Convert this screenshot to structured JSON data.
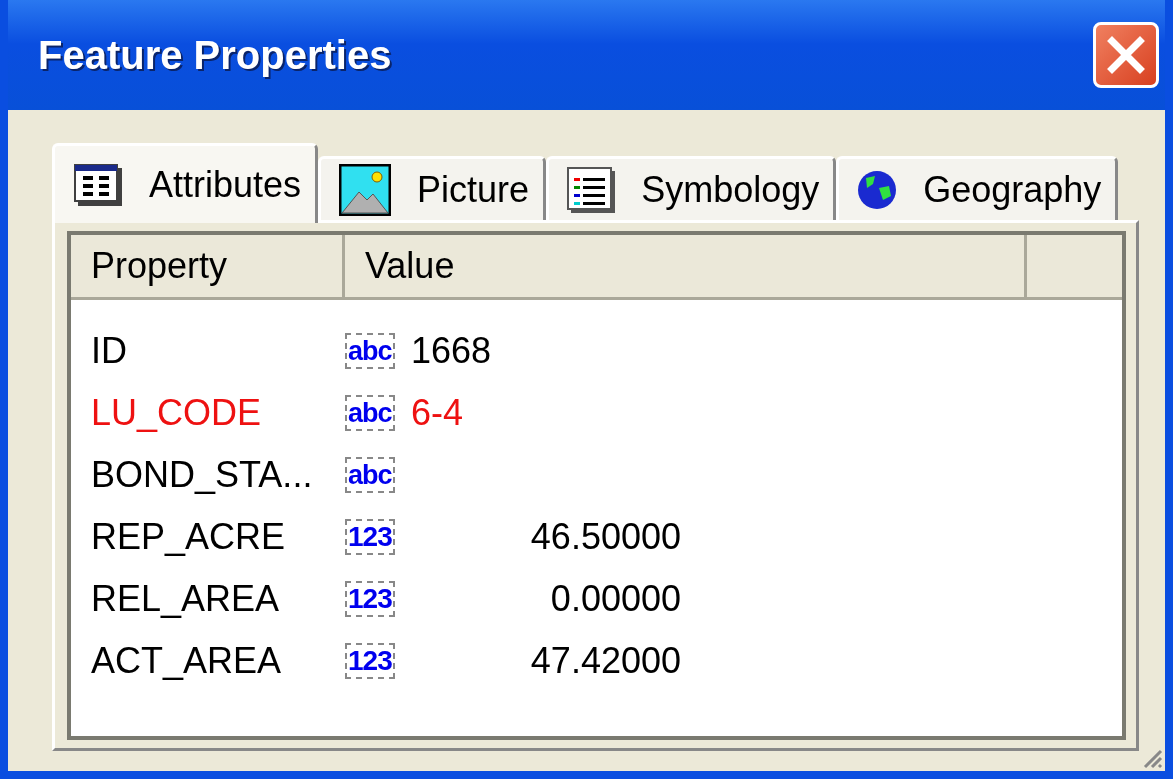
{
  "window": {
    "title": "Feature Properties"
  },
  "tabs": [
    {
      "label": "Attributes",
      "kind": "table",
      "selected": true
    },
    {
      "label": "Picture",
      "kind": "picture",
      "selected": false
    },
    {
      "label": "Symbology",
      "kind": "legend",
      "selected": false
    },
    {
      "label": "Geography",
      "kind": "globe",
      "selected": false
    }
  ],
  "table": {
    "columns": [
      "Property",
      "Value"
    ],
    "rows": [
      {
        "property": "ID",
        "kind": "text",
        "type_label": "abc",
        "value": "1668",
        "highlighted": false
      },
      {
        "property": "LU_CODE",
        "kind": "text",
        "type_label": "abc",
        "value": "6-4",
        "highlighted": true
      },
      {
        "property": "BOND_STA...",
        "kind": "text",
        "type_label": "abc",
        "highlighted": false
      },
      {
        "property": "REP_ACRE",
        "kind": "number",
        "type_label": "123",
        "value": "46.50000",
        "highlighted": false
      },
      {
        "property": "REL_AREA",
        "kind": "number",
        "type_label": "123",
        "value": "0.00000",
        "highlighted": false
      },
      {
        "property": "ACT_AREA",
        "kind": "number",
        "type_label": "123",
        "value": "47.42000",
        "highlighted": false
      }
    ]
  }
}
